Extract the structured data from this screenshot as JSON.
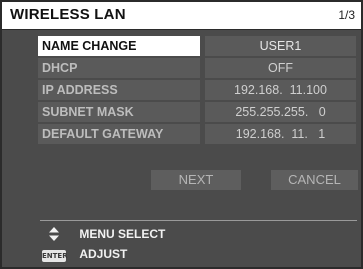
{
  "window": {
    "title": "WIRELESS LAN",
    "page_indicator": "1/3"
  },
  "settings": [
    {
      "label": "NAME CHANGE",
      "value": "USER1",
      "selected": true
    },
    {
      "label": "DHCP",
      "value": "OFF",
      "selected": false
    },
    {
      "label": "IP ADDRESS",
      "value": "192.168.  11.100",
      "selected": false
    },
    {
      "label": "SUBNET MASK",
      "value": "255.255.255.   0",
      "selected": false
    },
    {
      "label": "DEFAULT GATEWAY",
      "value": "192.168.  11.   1",
      "selected": false
    }
  ],
  "buttons": {
    "next_label": "NEXT",
    "cancel_label": "CANCEL"
  },
  "hints": {
    "menu_select": "MENU SELECT",
    "adjust": "ADJUST",
    "enter_key": "ENTER"
  },
  "icons": {
    "updown": "updown-arrows-icon",
    "enter": "enter-key-icon"
  }
}
